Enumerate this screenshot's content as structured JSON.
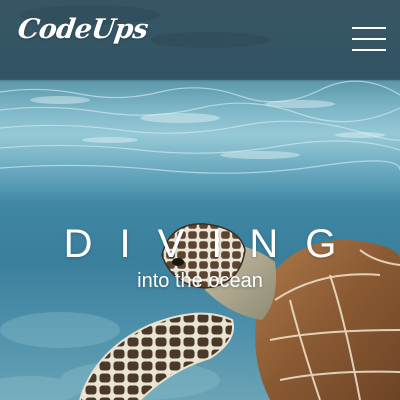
{
  "header": {
    "logo_text": "CodeUps",
    "menu_icon": "hamburger-menu-icon"
  },
  "hero": {
    "title": "DIVING",
    "subtitle": "into the ocean",
    "scene": "sea-turtle-underwater-image"
  }
}
